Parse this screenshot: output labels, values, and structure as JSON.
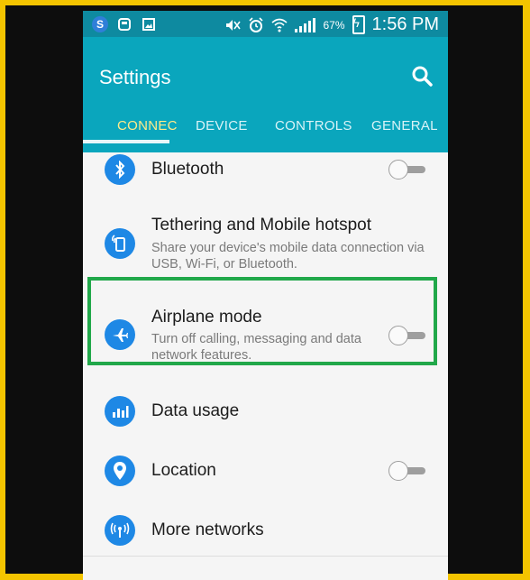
{
  "statusbar": {
    "battery_percent": "67%",
    "time": "1:56 PM",
    "left_icons": [
      "skype-icon",
      "usb-icon",
      "image-icon"
    ],
    "right_icons": [
      "mute-icon",
      "alarm-icon",
      "wifi-icon",
      "signal-icon",
      "battery-charging-icon"
    ]
  },
  "header": {
    "title": "Settings",
    "search_icon": "search-icon"
  },
  "tabs": [
    {
      "label": "CONNECTIONS",
      "visible_label": "CONNEC",
      "active": true
    },
    {
      "label": "DEVICE",
      "active": false
    },
    {
      "label": "CONTROLS",
      "active": false
    },
    {
      "label": "GENERAL",
      "active": false
    }
  ],
  "settings": {
    "bluetooth": {
      "title": "Bluetooth",
      "icon": "bluetooth-icon",
      "toggle": "off"
    },
    "tethering": {
      "title": "Tethering and Mobile hotspot",
      "subtitle": "Share your device's mobile data connection via USB, Wi-Fi, or Bluetooth.",
      "icon": "hotspot-icon"
    },
    "airplane": {
      "title": "Airplane mode",
      "subtitle": "Turn off calling, messaging and data network features.",
      "icon": "airplane-icon",
      "toggle": "off"
    },
    "data_usage": {
      "title": "Data usage",
      "icon": "data-usage-icon"
    },
    "location": {
      "title": "Location",
      "icon": "location-pin-icon",
      "toggle": "off"
    },
    "more_networks": {
      "title": "More networks",
      "icon": "antenna-icon"
    }
  },
  "colors": {
    "status_bar": "#0e8aa0",
    "app_bar": "#0aa6bd",
    "icon_blue": "#1e88e5",
    "highlight_green": "#21a84a",
    "frame_yellow": "#f4c400"
  }
}
